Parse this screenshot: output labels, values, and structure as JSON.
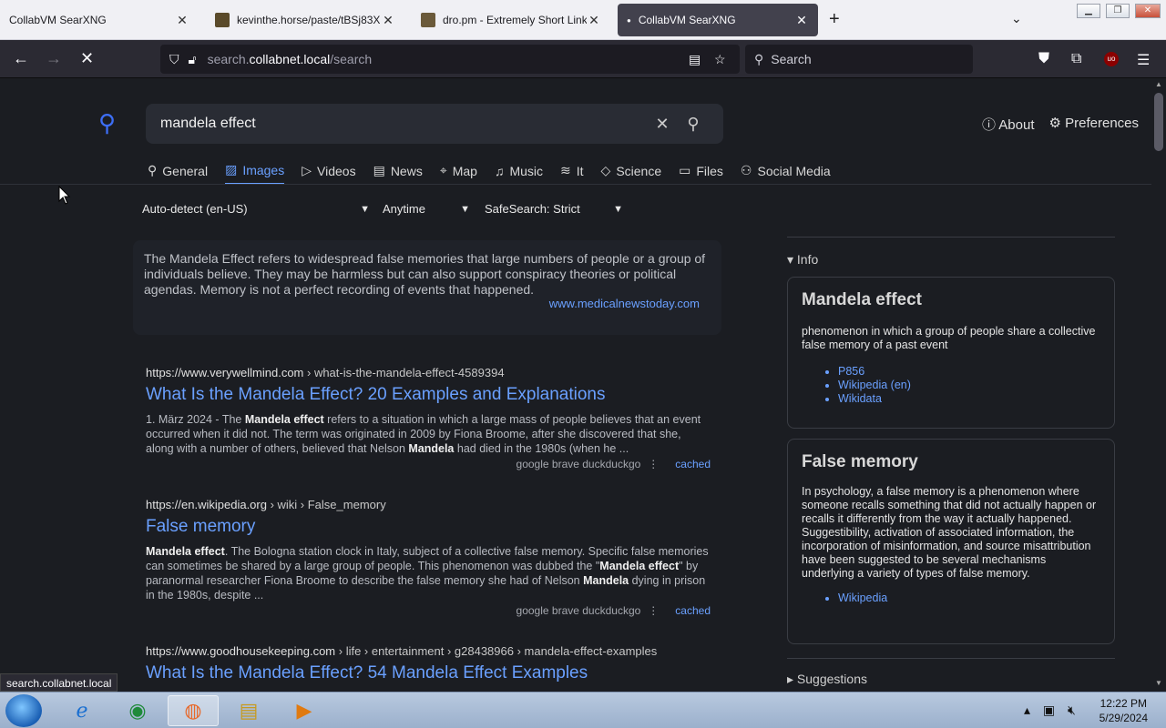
{
  "browser": {
    "tabs": [
      {
        "title": "CollabVM SearXNG",
        "active": false
      },
      {
        "title": "kevinthe.horse/paste/tBSj83XU",
        "active": false
      },
      {
        "title": "dro.pm - Extremely Short Links",
        "active": false
      },
      {
        "title": "CollabVM SearXNG",
        "active": true
      }
    ],
    "url_prefix": "search.",
    "url_host": "collabnet.local",
    "url_path": "/search",
    "search_placeholder": "Search"
  },
  "page": {
    "query": "mandela effect",
    "about": "About",
    "preferences": "Preferences",
    "categories": [
      {
        "label": "General",
        "icon": "search-icon"
      },
      {
        "label": "Images",
        "icon": "image-icon"
      },
      {
        "label": "Videos",
        "icon": "play-icon"
      },
      {
        "label": "News",
        "icon": "newspaper-icon"
      },
      {
        "label": "Map",
        "icon": "map-pin-icon"
      },
      {
        "label": "Music",
        "icon": "music-icon"
      },
      {
        "label": "It",
        "icon": "layers-icon"
      },
      {
        "label": "Science",
        "icon": "graduation-icon"
      },
      {
        "label": "Files",
        "icon": "files-icon"
      },
      {
        "label": "Social Media",
        "icon": "people-icon"
      }
    ],
    "selected_category": "Images",
    "filters": {
      "language": "Auto-detect (en-US)",
      "time": "Anytime",
      "safesearch": "SafeSearch: Strict"
    },
    "answer": {
      "text": "The Mandela Effect refers to widespread false memories that large numbers of people or a group of individuals believe. They may be harmless but can also support conspiracy theories or political agendas. Memory is not a perfect recording of events that happened.",
      "source": "www.medicalnewstoday.com"
    },
    "results": [
      {
        "url_host": "https://www.verywellmind.com",
        "url_path": " › what-is-the-mandela-effect-4589394",
        "title": "What Is the Mandela Effect? 20 Examples and Explanations",
        "snippet_parts": [
          "1. März 2024 - The ",
          "Mandela effect",
          " refers to a situation in which a large mass of people believes that an event occurred when it did not. The term was originated in 2009 by Fiona Broome, after she discovered that she, along with a number of others, believed that Nelson ",
          "Mandela",
          " had died in the 1980s (when he ..."
        ],
        "engines": "google  brave  duckduckgo",
        "cached": "cached"
      },
      {
        "url_host": "https://en.wikipedia.org",
        "url_path": " › wiki › False_memory",
        "title": "False memory",
        "snippet_parts": [
          "",
          "Mandela effect",
          ". The Bologna station clock in Italy, subject of a collective false memory. Specific false memories can sometimes be shared by a large group of people. This phenomenon was dubbed the \"",
          "Mandela effect",
          "\" by paranormal researcher Fiona Broome to describe the false memory she had of Nelson ",
          "Mandela",
          " dying in prison in the 1980s, despite ..."
        ],
        "engines": "google  brave  duckduckgo",
        "cached": "cached"
      },
      {
        "url_host": "https://www.goodhousekeeping.com",
        "url_path": " › life › entertainment › g28438966 › mandela-effect-examples",
        "title": "What Is the Mandela Effect? 54 Mandela Effect Examples"
      }
    ],
    "sidebar": {
      "info_label": "Info",
      "infoboxes": [
        {
          "title": "Mandela effect",
          "desc": "phenomenon in which a group of people share a collective false memory of a past event",
          "links": [
            "P856",
            "Wikipedia (en)",
            "Wikidata"
          ]
        },
        {
          "title": "False memory",
          "desc": "In psychology, a false memory is a phenomenon where someone recalls something that did not actually happen or recalls it differently from the way it actually happened. Suggestibility, activation of associated information, the incorporation of misinformation, and source misattribution have been suggested to be several mechanisms underlying a variety of types of false memory.",
          "links": [
            "Wikipedia"
          ]
        }
      ],
      "suggestions_label": "Suggestions"
    }
  },
  "status_url": "search.collabnet.local",
  "taskbar": {
    "time": "12:22 PM",
    "date": "5/29/2024"
  },
  "colors": {
    "accent": "#6aa0ff",
    "background": "#1b1d22",
    "logo": "#3d6ef5"
  }
}
